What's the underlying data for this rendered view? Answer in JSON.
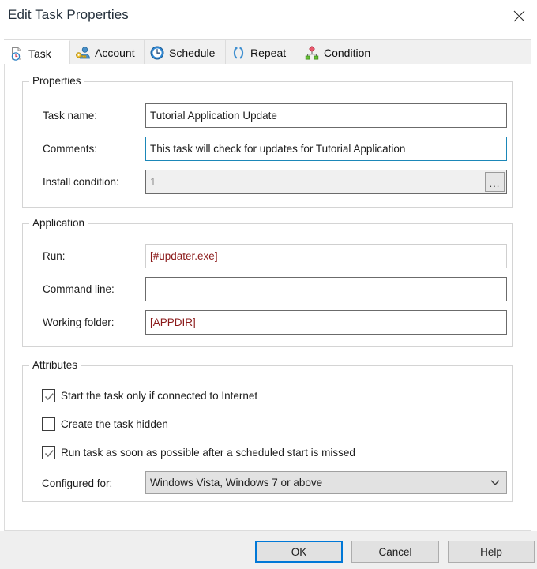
{
  "window": {
    "title": "Edit Task Properties",
    "close_label": "Close",
    "close_icon": "close-icon"
  },
  "tabs": [
    {
      "label": "Task",
      "icon": "document-clock-icon",
      "selected": true
    },
    {
      "label": "Account",
      "icon": "user-key-icon",
      "selected": false
    },
    {
      "label": "Schedule",
      "icon": "clock-icon",
      "selected": false
    },
    {
      "label": "Repeat",
      "icon": "repeat-arrows-icon",
      "selected": false
    },
    {
      "label": "Condition",
      "icon": "condition-node-icon",
      "selected": false
    }
  ],
  "properties": {
    "group_title": "Properties",
    "task_name": {
      "label": "Task name:",
      "value": "Tutorial Application Update",
      "placeholder": ""
    },
    "comments": {
      "label": "Comments:",
      "value": "This task will check for updates for Tutorial Application",
      "placeholder": ""
    },
    "install_condition": {
      "label": "Install condition:",
      "value": "1",
      "placeholder": "",
      "browse_label": "...",
      "disabled": true
    }
  },
  "application": {
    "group_title": "Application",
    "run": {
      "label": "Run:",
      "value": "[#updater.exe]",
      "placeholder": ""
    },
    "command_line": {
      "label": "Command line:",
      "value": "",
      "placeholder": ""
    },
    "working_folder": {
      "label": "Working folder:",
      "value": "[APPDIR]",
      "placeholder": ""
    }
  },
  "attributes": {
    "group_title": "Attributes",
    "checkboxes": [
      {
        "label": "Start the task only if connected to Internet",
        "checked": true
      },
      {
        "label": "Create the task hidden",
        "checked": false
      },
      {
        "label": "Run task as soon as possible after a scheduled start is missed",
        "checked": true
      }
    ],
    "configured_for": {
      "label": "Configured for:",
      "value": "Windows Vista, Windows 7 or above",
      "arrow_icon": "chevron-down-icon"
    }
  },
  "footer": {
    "ok": "OK",
    "cancel": "Cancel",
    "help": "Help"
  },
  "colors": {
    "accent": "#0078d7",
    "variable_text": "#8b1a1a",
    "title_text": "#24303c",
    "focus_border": "#1b87b8"
  }
}
